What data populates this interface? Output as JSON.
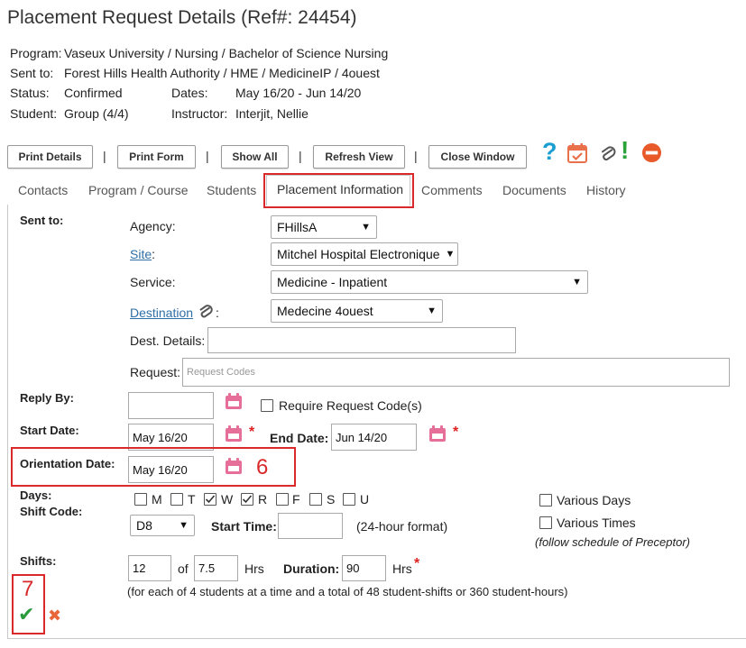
{
  "page": {
    "title": "Placement Request Details (Ref#: 24454)"
  },
  "meta": {
    "program_label": "Program:",
    "program_value": "Vaseux University / Nursing / Bachelor of Science Nursing",
    "sent_label": "Sent to:",
    "sent_value": "Forest Hills Health Authority / HME / MedicineIP / 4ouest",
    "status_label": "Status:",
    "status_value": "Confirmed",
    "dates_label": "Dates:",
    "dates_value": "May 16/20 - Jun 14/20",
    "student_label": "Student:",
    "student_value": "Group (4/4)",
    "instructor_label": "Instructor:",
    "instructor_value": "Interjit, Nellie"
  },
  "toolbar": {
    "separator": "|",
    "print_details": "Print Details",
    "print_form": "Print Form",
    "show_all": "Show All",
    "refresh_view": "Refresh View",
    "close_window": "Close Window",
    "help_glyph": "?",
    "alert_glyph": "!"
  },
  "icons": {
    "help": "question-icon",
    "calendar": "calendar-check-icon",
    "attach": "paperclip-icon",
    "alert": "exclamation-icon",
    "remove": "no-entry-icon"
  },
  "colors": {
    "help": "#1b9fd2",
    "calendar": "#e8704a",
    "alert": "#2aa33a",
    "remove": "#e85a2a",
    "calendar_field": "#e66f9a",
    "required": "#dd2222",
    "highlight": "#d9292b",
    "check": "#2a9a3a",
    "cancel": "#e8663a"
  },
  "tabs": [
    {
      "label": "Contacts"
    },
    {
      "label": "Program / Course"
    },
    {
      "label": "Students"
    },
    {
      "label": "Placement Information"
    },
    {
      "label": "Comments"
    },
    {
      "label": "Documents"
    },
    {
      "label": "History"
    }
  ],
  "active_tab": "Placement Information",
  "form": {
    "sent_to_label": "Sent to:",
    "agency_label": "Agency:",
    "agency_value": "FHillsA",
    "site_label": "Site",
    "site_value": "Mitchel Hospital Electronique",
    "service_label": "Service:",
    "service_value": "Medicine - Inpatient",
    "destination_label": "Destination",
    "destination_value": "Medecine 4ouest",
    "dest_details_label": "Dest. Details:",
    "dest_details_value": "",
    "request_label": "Request:",
    "request_placeholder": "Request Codes",
    "reply_by_label": "Reply By:",
    "reply_by_value": "",
    "require_code_label": "Require Request Code(s)",
    "start_date_label": "Start Date:",
    "start_date_value": "May 16/20",
    "end_date_label": "End Date:",
    "end_date_value": "Jun 14/20",
    "orientation_label": "Orientation Date:",
    "orientation_value": "May 16/20",
    "days_label": "Days:",
    "shift_code_label": "Shift Code:",
    "days": [
      {
        "label": "M",
        "checked": false
      },
      {
        "label": "T",
        "checked": false
      },
      {
        "label": "W",
        "checked": true
      },
      {
        "label": "R",
        "checked": true
      },
      {
        "label": "F",
        "checked": false
      },
      {
        "label": "S",
        "checked": false
      },
      {
        "label": "U",
        "checked": false
      }
    ],
    "various_days_label": "Various Days",
    "various_times_label": "Various Times",
    "follow_schedule": "(follow schedule of Preceptor)",
    "shift_code_value": "D8",
    "start_time_label": "Start Time:",
    "start_time_value": "",
    "format_note": "(24-hour format)",
    "shifts_label": "Shifts:",
    "shifts_value": "12",
    "of_label": "of",
    "hrs_value": "7.5",
    "hrs_label": "Hrs",
    "duration_label": "Duration:",
    "duration_value": "90",
    "duration_hrs_label": "Hrs",
    "note": "(for each of 4 students at a time and a total of 48 student-shifts or 360 student-hours)",
    "required_mark": "*",
    "colon": ":"
  },
  "annotations": {
    "step6": "6",
    "step7": "7"
  },
  "actions": {
    "save_glyph": "✔",
    "cancel_glyph": "✖"
  }
}
